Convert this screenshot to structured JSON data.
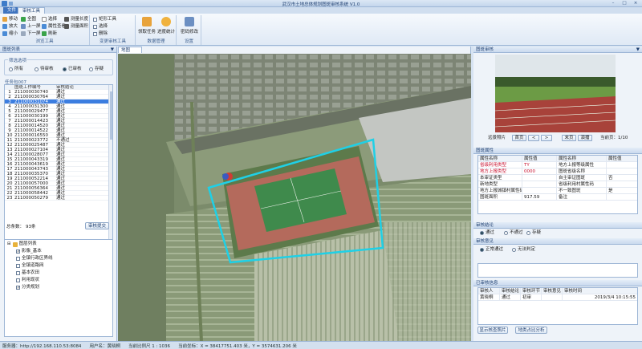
{
  "titlebar": {
    "title": "武汉市土地总体规划图斑审核系统 V1.0"
  },
  "tabs": {
    "file": "文件",
    "active": "审核工具"
  },
  "ribbon": {
    "browse": {
      "label": "浏览工具",
      "btn_pan": "移动",
      "btn_full": "全图",
      "btn_select": "选择",
      "btn_zoomin": "放大",
      "btn_prev": "上一屏",
      "btn_identify": "属性查看",
      "btn_zoomout": "缩小",
      "btn_next": "下一屏",
      "btn_refresh": "刷新",
      "btn_measure_len": "测量长度",
      "btn_measure_area": "测量面积"
    },
    "audit": {
      "label": "变更审核工具",
      "btn_draw_rect": "矩形工具",
      "btn_polygon": "选择",
      "btn_delete": "删除"
    },
    "data": {
      "label": "数据管理",
      "btn_task": "领取任务",
      "btn_stats": "进度统计"
    },
    "settings": {
      "label": "设置",
      "btn_password": "密码修改"
    }
  },
  "left": {
    "panel_title": "图斑列表",
    "filter": {
      "legend": "筛选选项",
      "options": [
        "所有",
        "待审核",
        "已审核",
        "存疑"
      ],
      "selected": 2
    },
    "tasks": {
      "legend": "任务包007",
      "headers": [
        "",
        "图斑工作编号",
        "审核结论"
      ],
      "rows": [
        [
          "1",
          "211000030740",
          "通过"
        ],
        [
          "2",
          "211000030764",
          "通过"
        ],
        [
          "3",
          "211000031074",
          "通过"
        ],
        [
          "4",
          "211000031300",
          "通过"
        ],
        [
          "5",
          "211000029477",
          "通过"
        ],
        [
          "6",
          "211000030199",
          "通过"
        ],
        [
          "7",
          "211000014423",
          "通过"
        ],
        [
          "8",
          "211000014520",
          "通过"
        ],
        [
          "9",
          "211000014522",
          "通过"
        ],
        [
          "10",
          "211000016550",
          "通过"
        ],
        [
          "11",
          "211000023772",
          "不通过"
        ],
        [
          "12",
          "211000025487",
          "通过"
        ],
        [
          "13",
          "211000027104",
          "通过"
        ],
        [
          "14",
          "211000028077",
          "通过"
        ],
        [
          "15",
          "211000043319",
          "通过"
        ],
        [
          "16",
          "211000043619",
          "通过"
        ],
        [
          "17",
          "211000043743",
          "通过"
        ],
        [
          "18",
          "211000035370",
          "通过"
        ],
        [
          "19",
          "211000052214",
          "通过"
        ],
        [
          "20",
          "211000057000",
          "通过"
        ],
        [
          "21",
          "211000056364",
          "通过"
        ],
        [
          "22",
          "211000058442",
          "通过"
        ],
        [
          "23",
          "211000050279",
          "通过"
        ]
      ],
      "selected_index": 2
    },
    "total_label": "总条数：",
    "total_value": "93条",
    "submit_label": "审核提交",
    "layers": {
      "root": "图层列表",
      "items": [
        {
          "label": "影像_基本",
          "checked": true
        },
        {
          "label": "全镇行政区界线",
          "checked": false
        },
        {
          "label": "全镇道路网",
          "checked": false
        },
        {
          "label": "基本农田",
          "checked": false
        },
        {
          "label": "利用现状",
          "checked": false
        },
        {
          "label": "分类规划",
          "checked": true
        }
      ]
    }
  },
  "map": {
    "tab": "地图"
  },
  "right": {
    "photo_title": "图斑审核",
    "photo_caption": "远景照片",
    "nav": {
      "first": "首页",
      "prev": "<",
      "next": ">",
      "last": "末页",
      "stop": "演播",
      "counter": "当前页：1/10"
    },
    "attrs": {
      "title": "图斑属性",
      "headers": [
        "属性名称",
        "属性值",
        "属性名称",
        "属性值"
      ],
      "rows": [
        [
          "省级利用类型",
          "TY",
          "地方上报等级属性",
          ""
        ],
        [
          "地方上报类型",
          "0000",
          "图斑省级名称",
          ""
        ],
        [
          "本审证类型",
          "",
          "自主审证图斑",
          "否"
        ],
        [
          "新地类型",
          "",
          "省级利用村属性码",
          ""
        ],
        [
          "地方上报城镇村属性码",
          "",
          "不一致图斑",
          "是"
        ],
        [
          "图斑面积",
          "917.59",
          "备注",
          ""
        ]
      ],
      "red_rows": [
        0,
        1
      ]
    },
    "conclusion": {
      "legend": "审核结论",
      "options": [
        "通过",
        "不通过",
        "存疑"
      ],
      "selected": 0
    },
    "opinion": {
      "legend": "审核意见",
      "options": [
        "正常通过",
        "无法判定"
      ],
      "selected": 0
    },
    "history": {
      "title": "已审核信息",
      "headers": [
        "审核人",
        "审核结论",
        "审核环节",
        "审核意见",
        "审核时间"
      ],
      "rows": [
        [
          "黄晓桐",
          "通过",
          "初审",
          "",
          "2019/3/4 10:15:55"
        ]
      ]
    },
    "btn_show_photo": "显示核查照片",
    "btn_overlay": "地类占比分析"
  },
  "status": {
    "server": "服务器：http://192.168.110.53:8084",
    "user": "用户名：黄晓桐",
    "scale": "当前比例尺 1 : 1036",
    "coords": "当前坐标：X = 38417751.403 米，Y = 3574631.206 米"
  },
  "colors": {
    "accent": "#3f74bf",
    "selected_row": "#3b7de0",
    "boundary": "#1fd0e6",
    "warning": "#c8102e"
  }
}
